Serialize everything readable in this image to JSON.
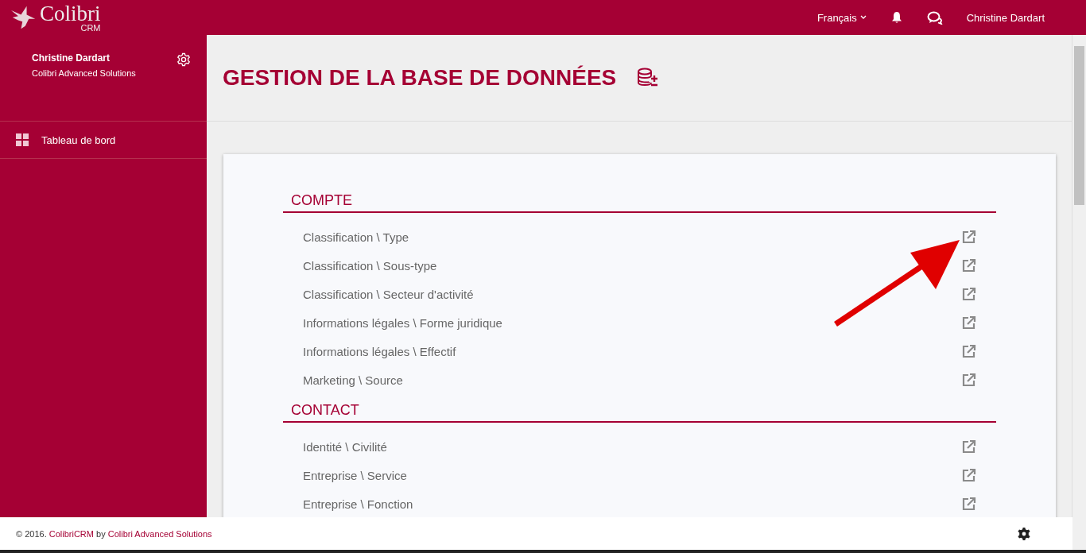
{
  "header": {
    "logo_name": "Colibri",
    "logo_sub": "CRM",
    "language": "Français",
    "user": "Christine Dardart"
  },
  "sidebar": {
    "user_name": "Christine Dardart",
    "company": "Colibri Advanced Solutions",
    "items": [
      {
        "label": "Tableau de bord",
        "selected": false
      }
    ]
  },
  "page": {
    "title": "GESTION DE LA BASE DE DONNÉES"
  },
  "sections": [
    {
      "title": "COMPTE",
      "rows": [
        {
          "label": "Classification \\ Type"
        },
        {
          "label": "Classification \\ Sous-type"
        },
        {
          "label": "Classification \\ Secteur d'activité"
        },
        {
          "label": "Informations légales \\ Forme juridique"
        },
        {
          "label": "Informations légales \\ Effectif"
        },
        {
          "label": "Marketing \\ Source"
        }
      ]
    },
    {
      "title": "CONTACT",
      "rows": [
        {
          "label": "Identité \\ Civilité"
        },
        {
          "label": "Entreprise \\ Service"
        },
        {
          "label": "Entreprise \\ Fonction"
        }
      ]
    }
  ],
  "footer": {
    "prefix": "© 2016. ",
    "brand_link": "ColibriCRM",
    "by": " by ",
    "company_link": "Colibri Advanced Solutions"
  }
}
